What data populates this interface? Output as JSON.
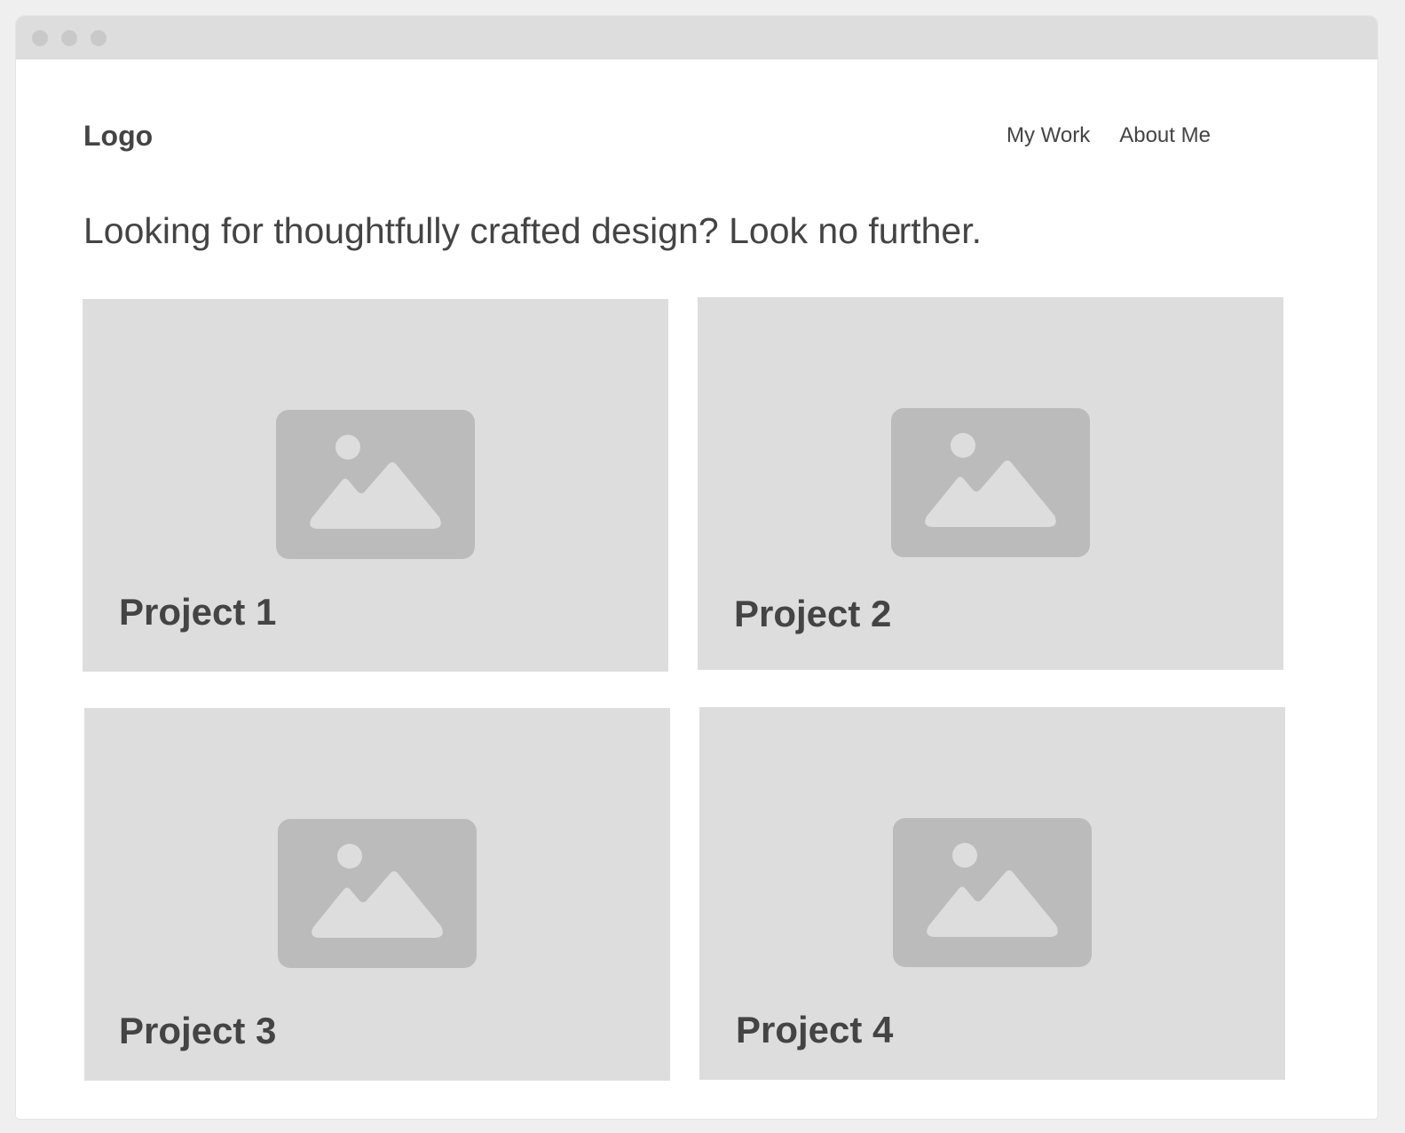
{
  "window": {
    "controls": [
      "close-dot",
      "minimize-dot",
      "maximize-dot"
    ]
  },
  "header": {
    "logo": "Logo",
    "nav": [
      {
        "label": "My Work"
      },
      {
        "label": "About Me"
      }
    ]
  },
  "hero": {
    "headline": "Looking for thoughtfully crafted design? Look no further."
  },
  "projects": [
    {
      "title": "Project 1",
      "icon": "image-placeholder-icon"
    },
    {
      "title": "Project 2",
      "icon": "image-placeholder-icon"
    },
    {
      "title": "Project 3",
      "icon": "image-placeholder-icon"
    },
    {
      "title": "Project 4",
      "icon": "image-placeholder-icon"
    }
  ],
  "colors": {
    "page_background": "#efefef",
    "window_background": "#ffffff",
    "titlebar": "#dddddd",
    "card_background": "#dddddd",
    "icon_frame": "#bbbbbb",
    "text": "#444444"
  }
}
